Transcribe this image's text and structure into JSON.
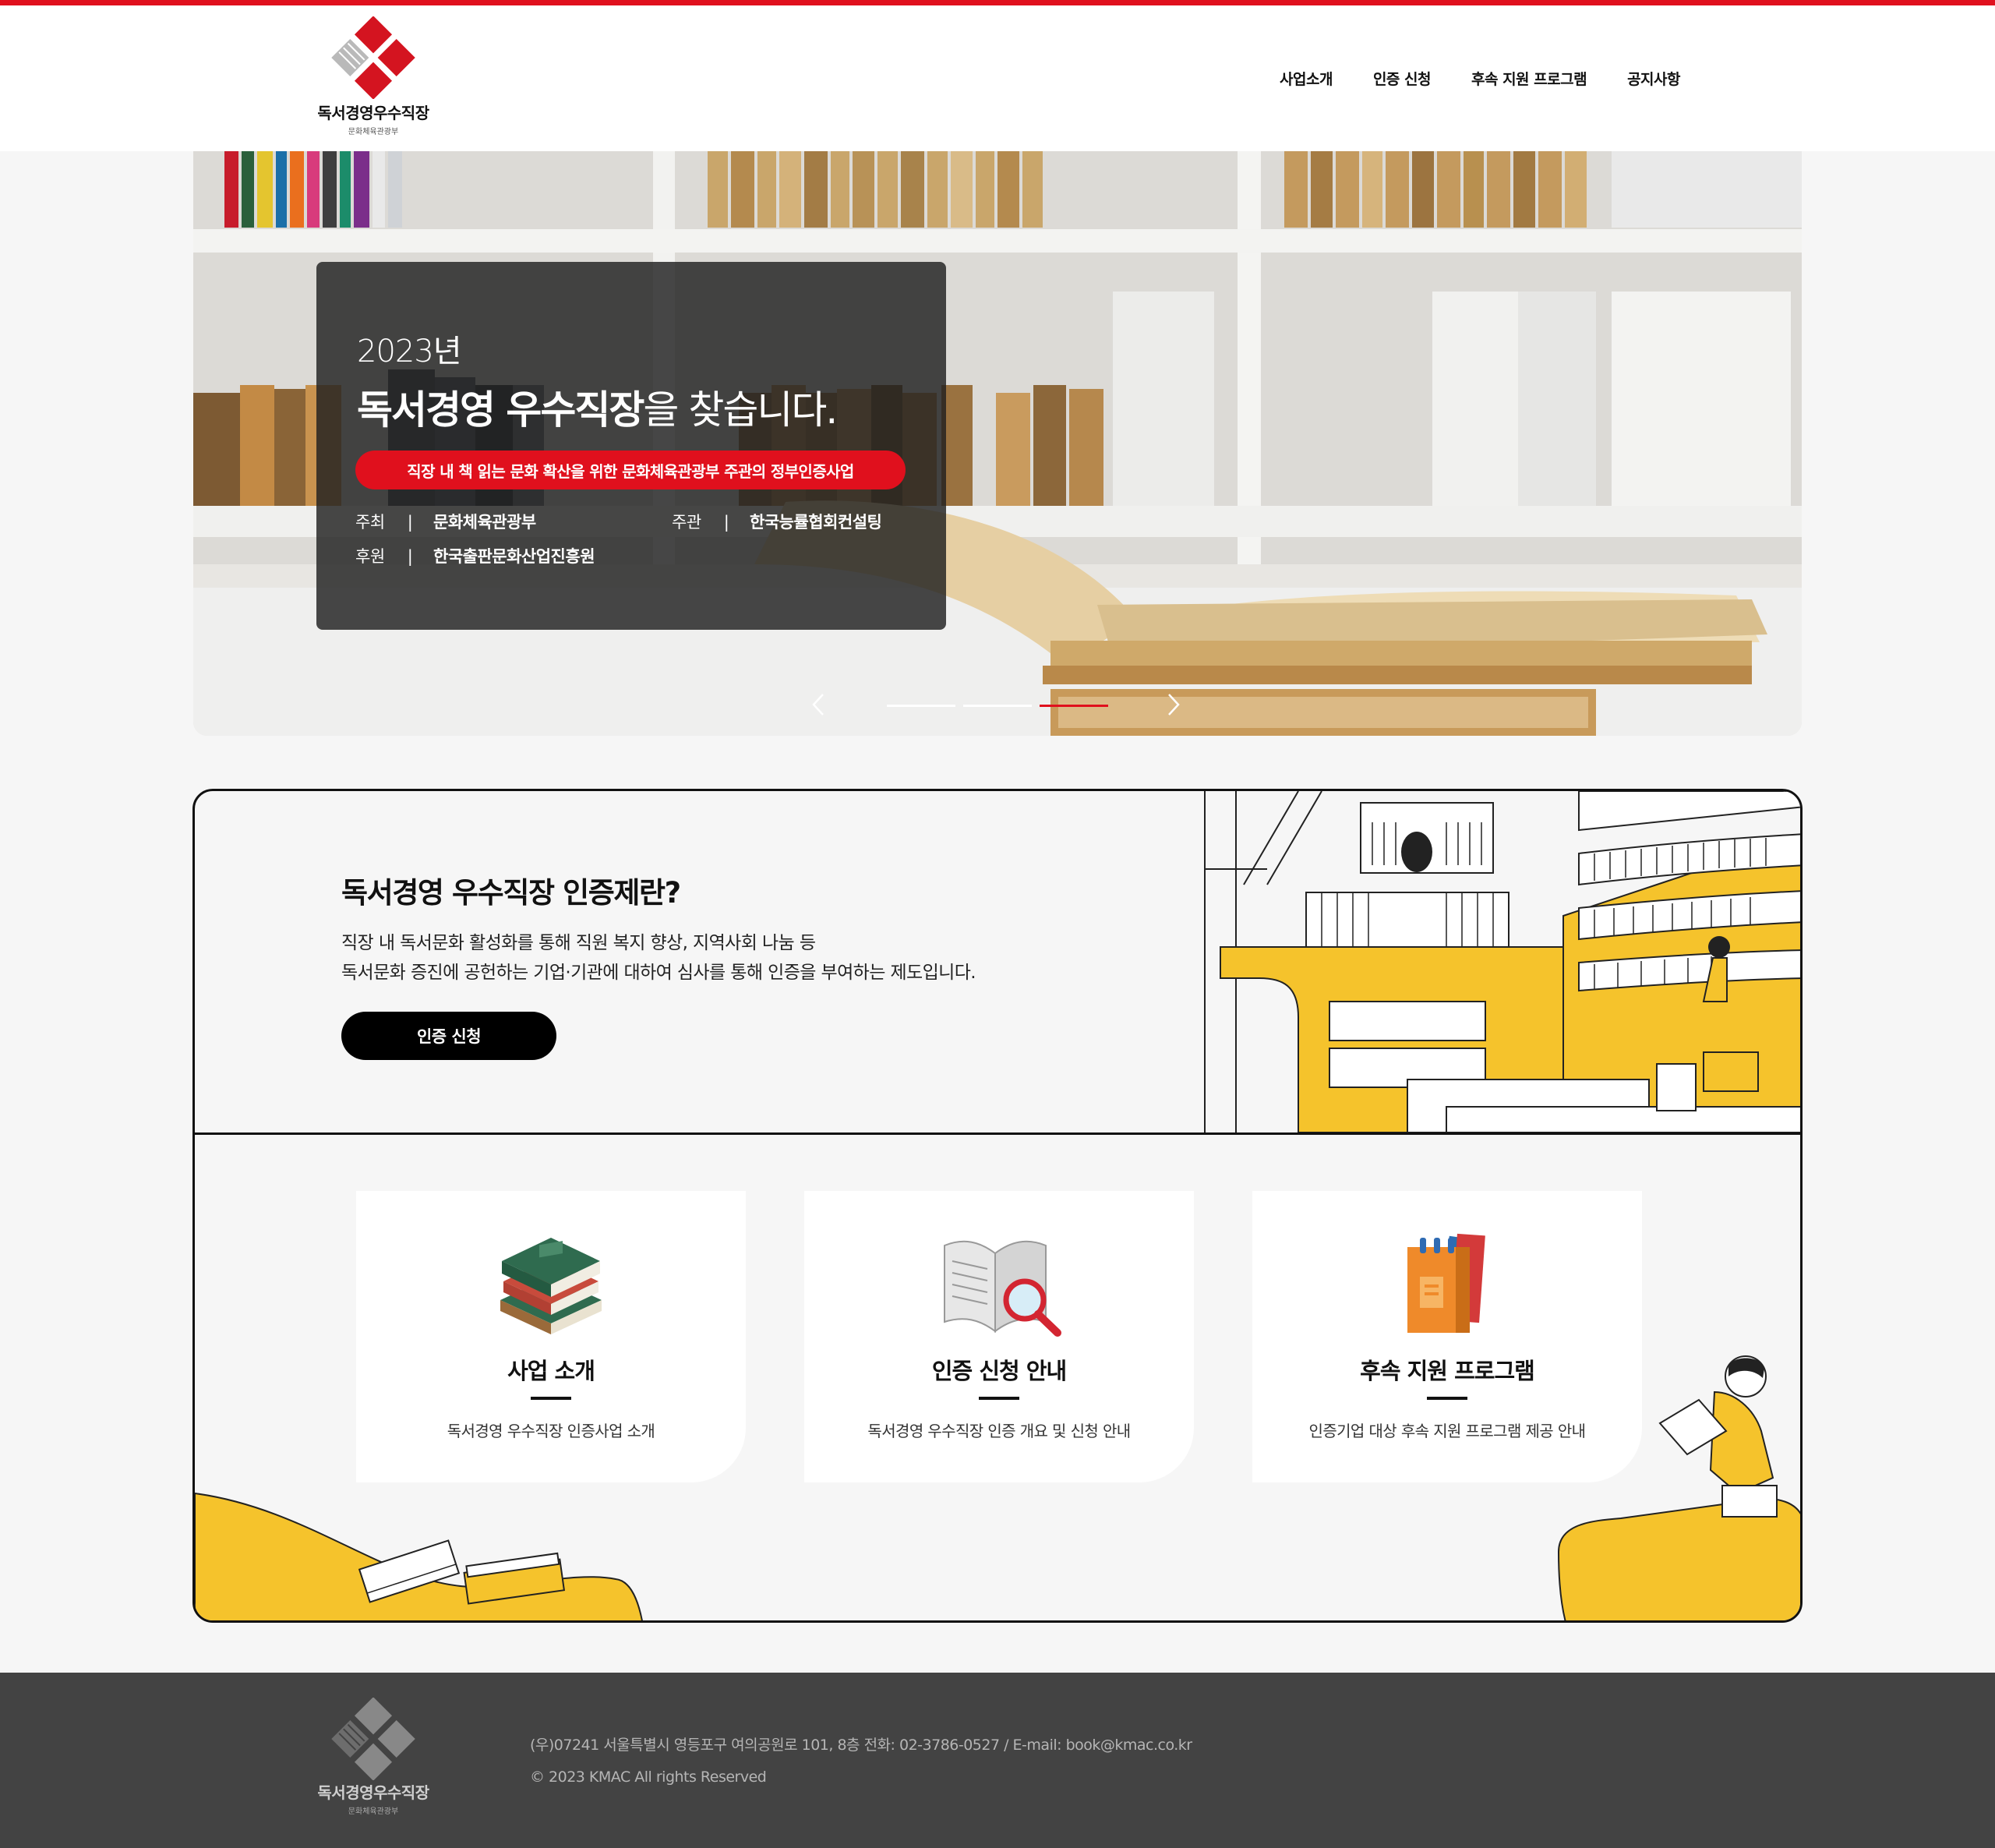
{
  "brand": {
    "name": "독서경영우수직장",
    "ministry": "문화체육관광부"
  },
  "nav": {
    "items": [
      "사업소개",
      "인증 신청",
      "후속 지원 프로그램",
      "공지사항"
    ]
  },
  "hero": {
    "year": "2023년",
    "title_bold": "독서경영 우수직장",
    "title_rest": "을 찾습니다.",
    "pill": "직장 내 책 읽는 문화 확산을 위한 문화체육관광부 주관의 정부인증사업",
    "info": [
      {
        "key": "주최",
        "sep": "|",
        "value": "문화체육관광부"
      },
      {
        "key": "주관",
        "sep": "|",
        "value": "한국능률협회컨설팅"
      },
      {
        "key": "후원",
        "sep": "|",
        "value": "한국출판문화산업진흥원"
      }
    ],
    "slider": {
      "total": 3,
      "active": 3
    }
  },
  "intro": {
    "title": "독서경영 우수직장 인증제란?",
    "desc_line1": "직장 내 독서문화 활성화를 통해 직원 복지 향상, 지역사회 나눔 등",
    "desc_line2": "독서문화 증진에 공헌하는 기업·기관에 대하여 심사를 통해 인증을 부여하는 제도입니다.",
    "button": "인증 신청"
  },
  "cards": [
    {
      "title": "사업 소개",
      "desc": "독서경영 우수직장 인증사업 소개",
      "icon": "books-stack-icon"
    },
    {
      "title": "인증 신청 안내",
      "desc": "독서경영 우수직장 인증 개요 및 신청 안내",
      "icon": "magnifier-book-icon"
    },
    {
      "title": "후속 지원 프로그램",
      "desc": "인증기업 대상 후속 지원 프로그램 제공 안내",
      "icon": "binders-icon"
    }
  ],
  "footer": {
    "address": "(우)07241 서울특별시 영등포구 여의공원로 101, 8층 전화: 02-3786-0527 / E-mail: book@kmac.co.kr",
    "copyright": "© 2023 KMAC All rights Reserved"
  },
  "colors": {
    "accent": "#e0101d",
    "yellow": "#f5c32c",
    "footer_bg": "#434343"
  }
}
